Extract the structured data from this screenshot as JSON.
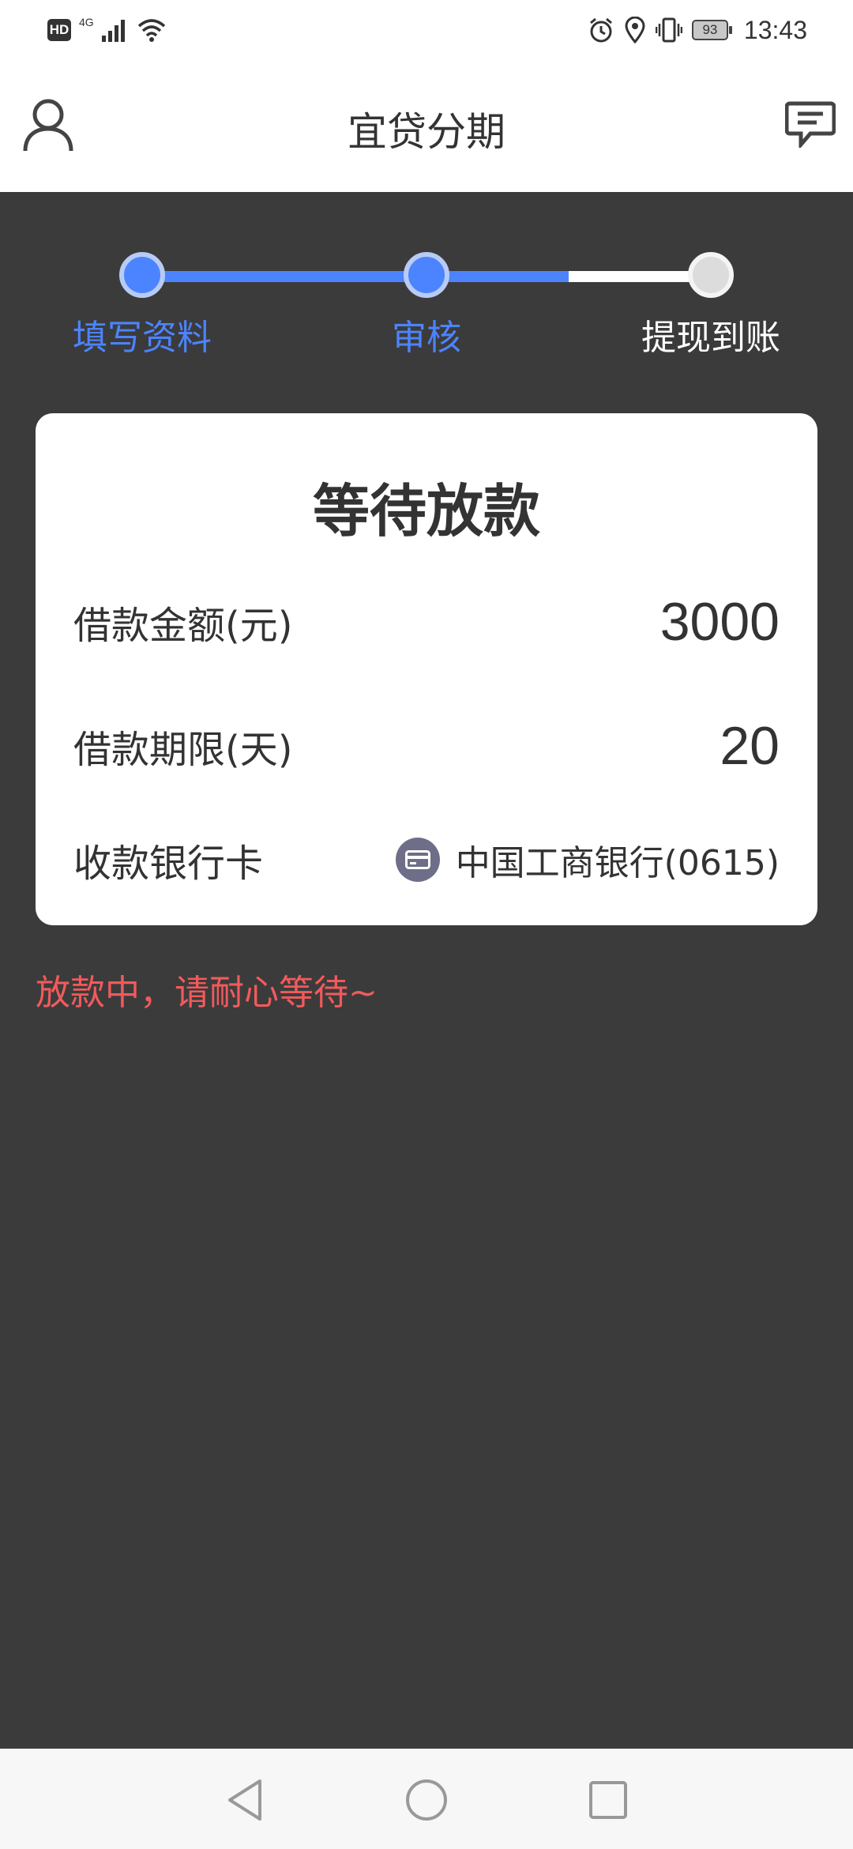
{
  "status_bar": {
    "hd": "HD",
    "network": "4G",
    "battery": "93",
    "time": "13:43"
  },
  "header": {
    "title": "宜贷分期"
  },
  "steps": [
    {
      "label": "填写资料",
      "state": "done"
    },
    {
      "label": "审核",
      "state": "done"
    },
    {
      "label": "提现到账",
      "state": "pending"
    }
  ],
  "card": {
    "title": "等待放款",
    "amount_label": "借款金额(元)",
    "amount_value": "3000",
    "term_label": "借款期限(天)",
    "term_value": "20",
    "bank_label": "收款银行卡",
    "bank_value": "中国工商银行(0615)"
  },
  "notice": "放款中，请耐心等待~",
  "colors": {
    "accent": "#4c84ff",
    "background": "#3b3b3c",
    "notice": "#f25a5a"
  }
}
